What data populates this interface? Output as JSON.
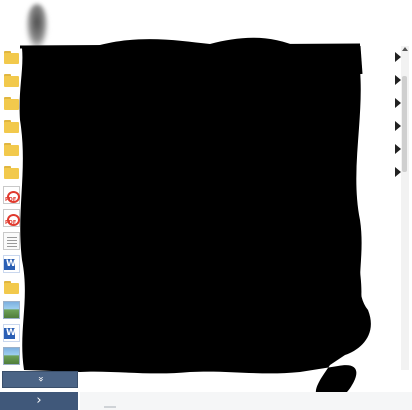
{
  "colors": {
    "folder": "#f2c94c",
    "pdf_red": "#e03a2e",
    "word_blue": "#2b5fb4",
    "nav_button": "#40587a",
    "redaction": "#000000"
  },
  "file_list": [
    {
      "icon": "folder-icon",
      "name": "",
      "has_submenu": true
    },
    {
      "icon": "folder-icon",
      "name": "",
      "has_submenu": true
    },
    {
      "icon": "folder-icon",
      "name": "",
      "has_submenu": true
    },
    {
      "icon": "folder-icon",
      "name": "",
      "has_submenu": true
    },
    {
      "icon": "folder-icon",
      "name": "",
      "has_submenu": true
    },
    {
      "icon": "folder-icon",
      "name": "",
      "has_submenu": true
    },
    {
      "icon": "pdf-icon",
      "name": "",
      "has_submenu": false
    },
    {
      "icon": "pdf-icon",
      "name": "",
      "has_submenu": false
    },
    {
      "icon": "document-icon",
      "name": "",
      "has_submenu": false
    },
    {
      "icon": "word-icon",
      "name": "",
      "has_submenu": false
    },
    {
      "icon": "folder-icon",
      "name": "",
      "has_submenu": false
    },
    {
      "icon": "image-icon",
      "name": "",
      "has_submenu": false
    },
    {
      "icon": "word-icon",
      "name": "",
      "has_submenu": false
    },
    {
      "icon": "image-icon",
      "name": "",
      "has_submenu": false
    }
  ],
  "bottom_nav": {
    "expand_icon": "double-chevron-down-icon",
    "expand_glyph": "»",
    "next_icon": "chevron-right-icon",
    "next_glyph": "›"
  }
}
